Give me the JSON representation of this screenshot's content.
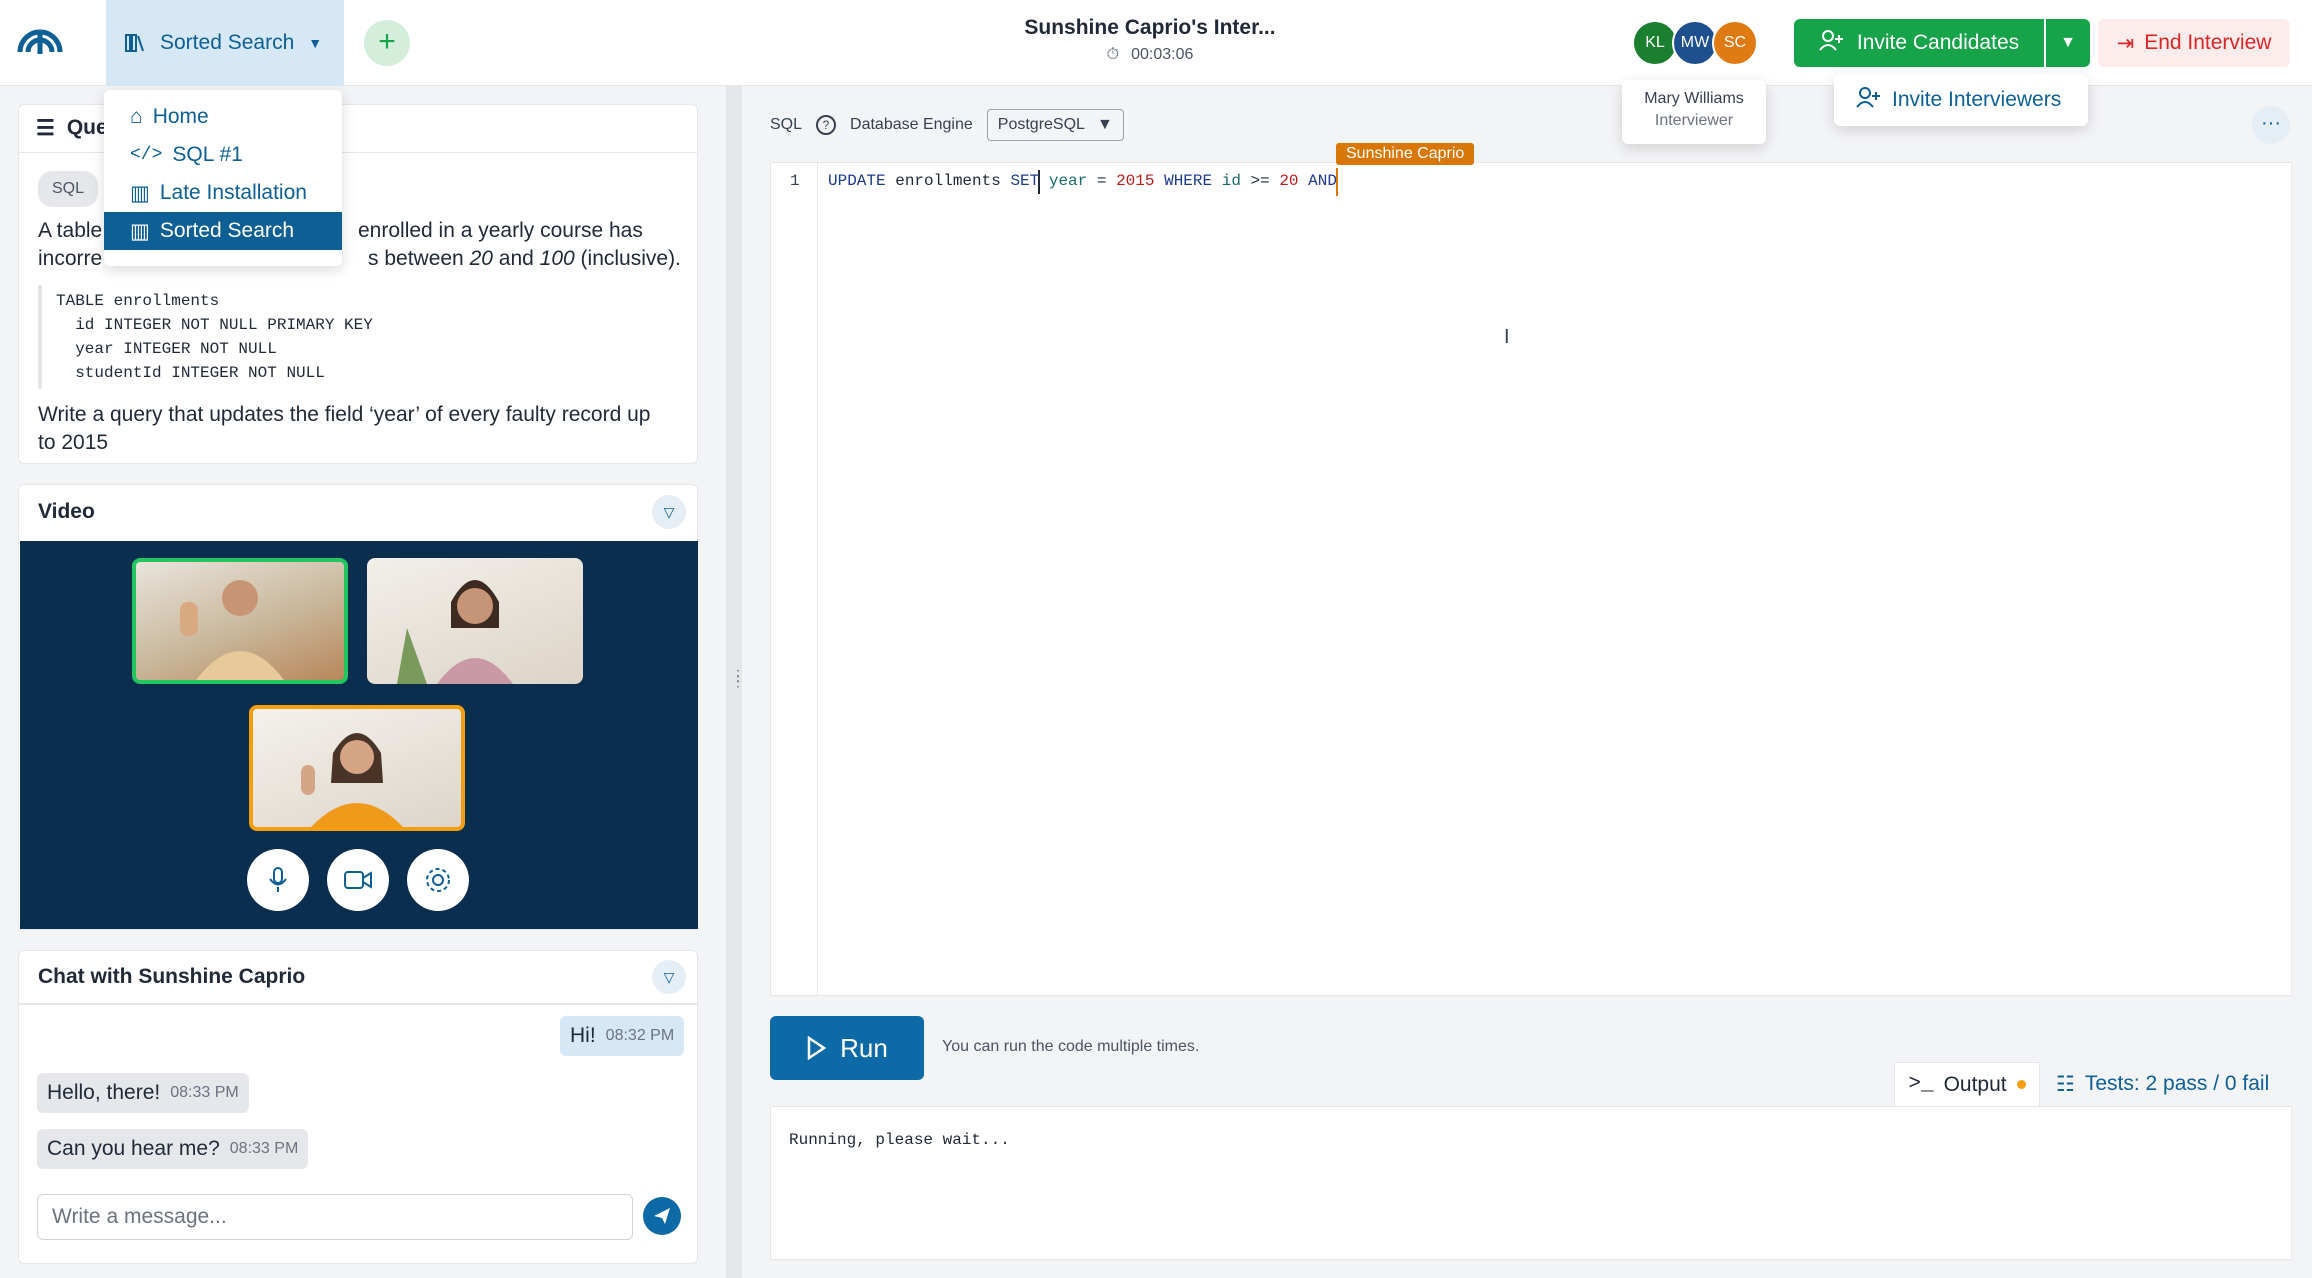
{
  "header": {
    "question_selector": "Sorted Search",
    "session_title": "Sunshine Caprio's Inter...",
    "timer": "00:03:06",
    "avatars": [
      {
        "initials": "KL",
        "color": "#1a7f2e"
      },
      {
        "initials": "MW",
        "color": "#1e4f8f"
      },
      {
        "initials": "SC",
        "color": "#e07b14"
      }
    ],
    "invite_candidates": "Invite Candidates",
    "end_interview": "End Interview",
    "invite_interviewers": "Invite Interviewers",
    "tooltip": {
      "name": "Mary Williams",
      "role": "Interviewer"
    }
  },
  "question_menu": {
    "items": [
      "Home",
      "SQL #1",
      "Late Installation",
      "Sorted Search"
    ],
    "selected": "Sorted Search"
  },
  "question": {
    "title": "Que",
    "tag": "SQL",
    "text_a": "A table",
    "text_a2": "enrolled in a yearly course has",
    "text_b": "incorre",
    "text_b2": "s between ",
    "lo": "20",
    "and": " and ",
    "hi": "100",
    "inclusive": " (inclusive).",
    "code": "TABLE enrollments\n  id INTEGER NOT NULL PRIMARY KEY\n  year INTEGER NOT NULL\n  studentId INTEGER NOT NULL",
    "text_c": "Write a query that updates the field ‘year’ of every faulty record up",
    "text_d": "to 2015"
  },
  "video": {
    "title": "Video"
  },
  "chat": {
    "title": "Chat with Sunshine Caprio",
    "messages": [
      {
        "text": "Hi!",
        "time": "08:32 PM",
        "mine": true
      },
      {
        "text": "Hello, there!",
        "time": "08:33 PM",
        "mine": false
      },
      {
        "text": "Can you hear me?",
        "time": "08:33 PM",
        "mine": false
      }
    ],
    "placeholder": "Write a message..."
  },
  "editor": {
    "language": "SQL",
    "engine_label": "Database Engine",
    "engine": "PostgreSQL",
    "line_number": "1",
    "code_tokens": [
      {
        "t": "UPDATE",
        "c": "kw"
      },
      {
        "t": " enrollments ",
        "c": ""
      },
      {
        "t": "SET",
        "c": "kw"
      },
      {
        "t": " year",
        "c": "id"
      },
      {
        "t": " = ",
        "c": ""
      },
      {
        "t": "2015",
        "c": "num"
      },
      {
        "t": " ",
        "c": ""
      },
      {
        "t": "WHERE",
        "c": "kw"
      },
      {
        "t": " id",
        "c": "id"
      },
      {
        "t": " >= ",
        "c": ""
      },
      {
        "t": "20",
        "c": "num"
      },
      {
        "t": " ",
        "c": ""
      },
      {
        "t": "AND",
        "c": "kw"
      }
    ],
    "cursor_user": "Sunshine Caprio",
    "run": "Run",
    "run_hint": "You can run the code multiple times.",
    "output_tab": "Output",
    "tests_tab": "Tests: 2 pass / 0 fail",
    "output_text": "Running, please wait..."
  }
}
